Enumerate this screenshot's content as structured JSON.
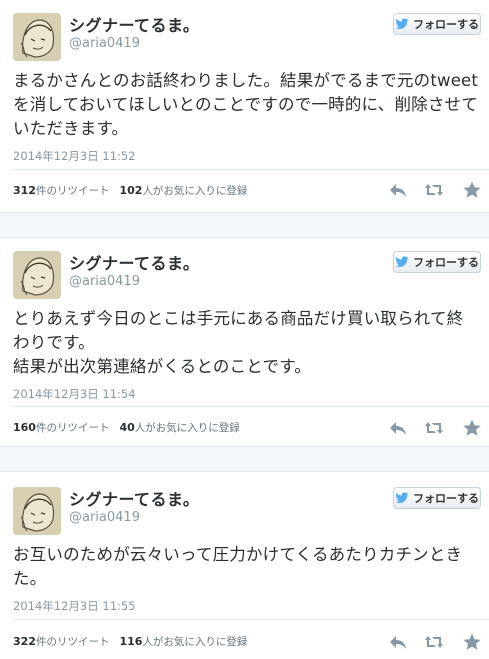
{
  "colors": {
    "follow_bird": "#55acee",
    "icon_gray": "#8899a6",
    "text": "#292f33",
    "muted": "#8899a6"
  },
  "tweets": [
    {
      "name": "シグナーてるま。",
      "handle": "@aria0419",
      "follow_label": "フォローする",
      "text": "まるかさんとのお話終わりました。結果がでるまで元のtweet\nを消しておいてほしいとのことですので一時的に、削除させて\nいただきます。",
      "time": "2014年12月3日  11:52",
      "retweet_count": "312",
      "retweet_label": "件のリツイート",
      "fav_count": "102",
      "fav_label": "人がお気に入りに登録",
      "icons": {
        "reply": "reply-icon",
        "retweet": "retweet-icon",
        "favorite": "star-icon"
      }
    },
    {
      "name": "シグナーてるま。",
      "handle": "@aria0419",
      "follow_label": "フォローする",
      "text": "とりあえず今日のとこは手元にある商品だけ買い取られて終\nわりです。\n結果が出次第連絡がくるとのことです。",
      "time": "2014年12月3日  11:54",
      "retweet_count": "160",
      "retweet_label": "件のリツイート",
      "fav_count": "40",
      "fav_label": "人がお気に入りに登録",
      "icons": {
        "reply": "reply-icon",
        "retweet": "retweet-icon",
        "favorite": "star-icon"
      }
    },
    {
      "name": "シグナーてるま。",
      "handle": "@aria0419",
      "follow_label": "フォローする",
      "text": "お互いのためが云々いって圧力かけてくるあたりカチンとき\nた。",
      "time": "2014年12月3日  11:55",
      "retweet_count": "322",
      "retweet_label": "件のリツイート",
      "fav_count": "116",
      "fav_label": "人がお気に入りに登録",
      "icons": {
        "reply": "reply-icon",
        "retweet": "retweet-icon",
        "favorite": "star-icon"
      }
    }
  ]
}
